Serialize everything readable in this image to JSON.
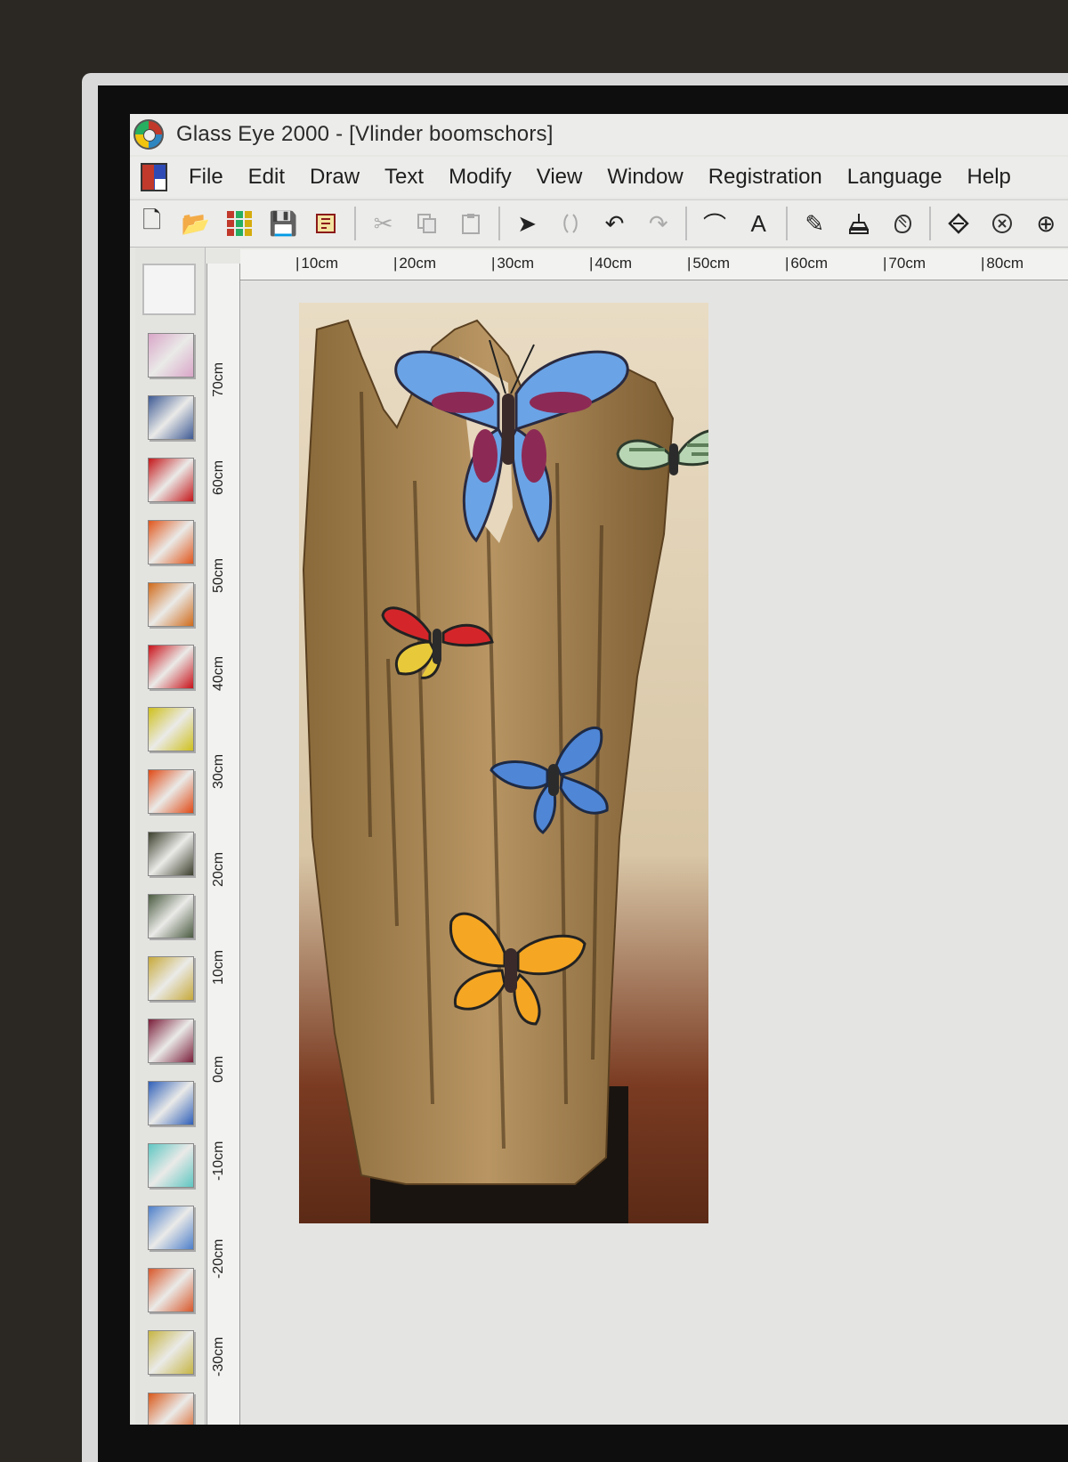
{
  "window": {
    "title": "Glass Eye 2000 - [Vlinder boomschors]"
  },
  "menu": {
    "items": [
      "File",
      "Edit",
      "Draw",
      "Text",
      "Modify",
      "View",
      "Window",
      "Registration",
      "Language",
      "Help"
    ]
  },
  "toolbar": {
    "new": "🗋",
    "open": "📂",
    "save": "💾",
    "cut": "✂",
    "undo": "↶",
    "redo": "↷",
    "select": "➤",
    "curve": "⌒",
    "text_tool": "A",
    "pencil": "✎",
    "cursor": "⊕"
  },
  "rulers": {
    "horizontal": [
      "10cm",
      "20cm",
      "30cm",
      "40cm",
      "50cm",
      "60cm",
      "70cm",
      "80cm"
    ],
    "vertical": [
      "70cm",
      "60cm",
      "50cm",
      "40cm",
      "30cm",
      "20cm",
      "10cm",
      "0cm",
      "-10cm",
      "-20cm",
      "-30cm"
    ]
  },
  "palette": {
    "colors": [
      "#d9a6c8",
      "#3e5a94",
      "#c4171a",
      "#e0561c",
      "#d06a1a",
      "#c9121a",
      "#cfc01c",
      "#e04a16",
      "#3b3f2c",
      "#4a5a40",
      "#c7a93a",
      "#7a1e3a",
      "#2f5fb8",
      "#5ec6c2",
      "#4d7fca",
      "#d8572a",
      "#c6b443",
      "#d9581a"
    ]
  }
}
